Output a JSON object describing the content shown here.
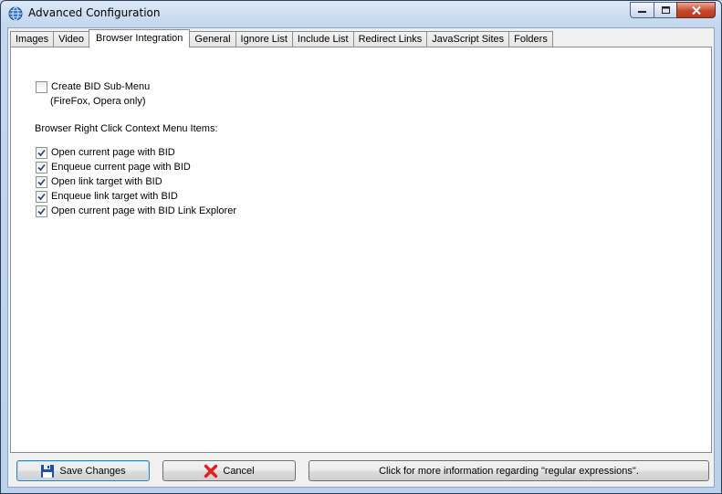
{
  "window": {
    "title": "Advanced Configuration"
  },
  "tabs": [
    {
      "label": "Images"
    },
    {
      "label": "Video"
    },
    {
      "label": "Browser Integration",
      "active": true
    },
    {
      "label": "General"
    },
    {
      "label": "Ignore List"
    },
    {
      "label": "Include List"
    },
    {
      "label": "Redirect Links"
    },
    {
      "label": "JavaScript Sites"
    },
    {
      "label": "Folders"
    }
  ],
  "panel": {
    "submenu": {
      "label": "Create BID Sub-Menu",
      "checked": false
    },
    "submenu_note": "(FireFox, Opera only)",
    "context_heading": "Browser Right Click Context Menu Items:",
    "context_items": [
      {
        "label": "Open current page with BID",
        "checked": true
      },
      {
        "label": "Enqueue current page with BID",
        "checked": true
      },
      {
        "label": "Open link target with BID",
        "checked": true
      },
      {
        "label": "Enqueue link target with BID",
        "checked": true
      },
      {
        "label": "Open current page with BID Link Explorer",
        "checked": true
      }
    ]
  },
  "footer": {
    "save_label": "Save Changes",
    "cancel_label": "Cancel",
    "info_label": "Click for more information regarding \"regular expressions\"."
  },
  "icons": {
    "app": "globe-icon",
    "save": "floppy-disk-icon",
    "cancel": "red-x-icon"
  },
  "colors": {
    "cancel_icon": "#e02020",
    "save_icon": "#1f4fa8",
    "close_button": "#c6482b"
  }
}
